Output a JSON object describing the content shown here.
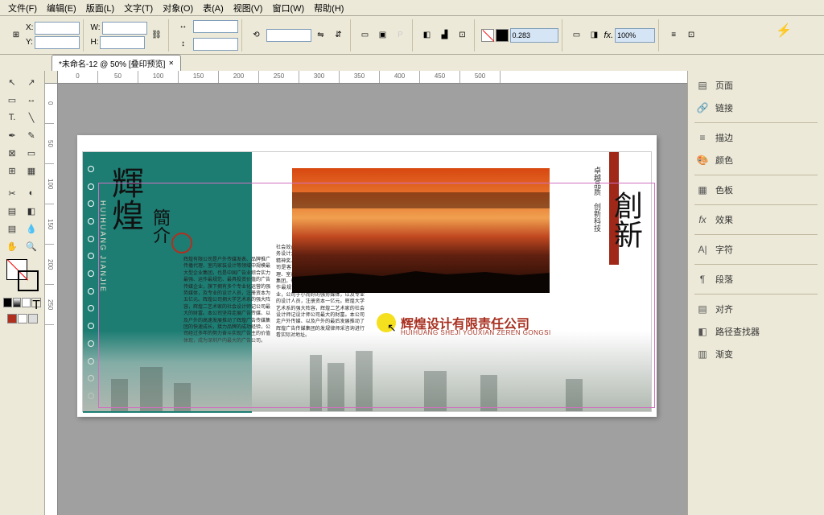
{
  "menu": {
    "file": "文件(F)",
    "edit": "编辑(E)",
    "layout": "版面(L)",
    "text": "文字(T)",
    "object": "对象(O)",
    "table": "表(A)",
    "view": "视图(V)",
    "window": "窗口(W)",
    "help": "帮助(H)"
  },
  "toolbar": {
    "x_label": "X:",
    "y_label": "Y:",
    "w_label": "W:",
    "h_label": "H:",
    "x_val": "",
    "y_val": "",
    "w_val": "",
    "h_val": "",
    "stroke_val": "0.283",
    "zoom_val": "100%"
  },
  "tab": {
    "title": "*未命名-12 @ 50% [叠印预览]"
  },
  "ruler_h": [
    "0",
    "50",
    "100",
    "150",
    "200",
    "250",
    "300",
    "350",
    "400",
    "450",
    "500"
  ],
  "ruler_v": [
    "0",
    "50",
    "100",
    "150",
    "200",
    "250"
  ],
  "artwork": {
    "wm1": "HUIHUANG JIANJIE",
    "wm2": "HUIHUANG JIANJIE",
    "wm3": "HUIHUANG JIAN JIE",
    "title_main": "輝煌",
    "title_sub": "簡介",
    "vtext": "HUIHUANG JIANJIE",
    "right_small": "卓越品质　创新科技",
    "right_big": "創新",
    "company_cn": "辉煌设计有限责任公司",
    "company_pin": "HUIHUANG SHEJI YOUXIAN ZEREN GONGSI",
    "body1": "辉煌有限公司是户外传媒发表、品牌推广传播代理、室内家装设计等领域中规模最大型企业集团，也是中国广告业综合实力最强、运作最规范、最具投资价值的广告传媒企业，旗下拥有多个专业化运营的强势媒体，及专业的设计人员，注册资本为五亿元。辉煌公司拥大学艺术系的强大阵容，辉煌二艺术家的社会设计师记公司最大的财富。本公司坚持走展广告传媒、以及户外的高速发展推动了辉煌广告传媒集团的快速成长，接力品牌的成功经验，公司经过多年的努力奋斗实现广告主的价值体现，成为深圳户内最大的广告公司。",
    "body2": "社会效益和经济辉煌。辉煌推广传媒的业务设计大赛中分别获得奖项大赛艺术奖、精神奖、创意传媒大奖公司。辉煌有限公司是客户外传媒发表、品牌推广传播代理、室内家设计等领域中规模最大型企业集团，也是中国广告业综合实力最强、运作最规范、最具投资价值的广告传媒企业，公司于小而好的强势媒体，以及专业的设计人员，注册资本一亿元。辉煌大学艺术系的强大阵容，辉煌二艺术家的社会设计师记设计师公司最大的财富。本公司走户外传媒、以及户外的最后发展推动了辉煌广告传媒集团的发规律师采咨询进行看实际对地址。"
  },
  "panels": {
    "page": "页面",
    "link": "链接",
    "stroke": "描边",
    "color": "颜色",
    "swatch": "色板",
    "fx": "效果",
    "char": "字符",
    "para": "段落",
    "align": "对齐",
    "pathfinder": "路径查找器",
    "gradient": "渐变"
  }
}
